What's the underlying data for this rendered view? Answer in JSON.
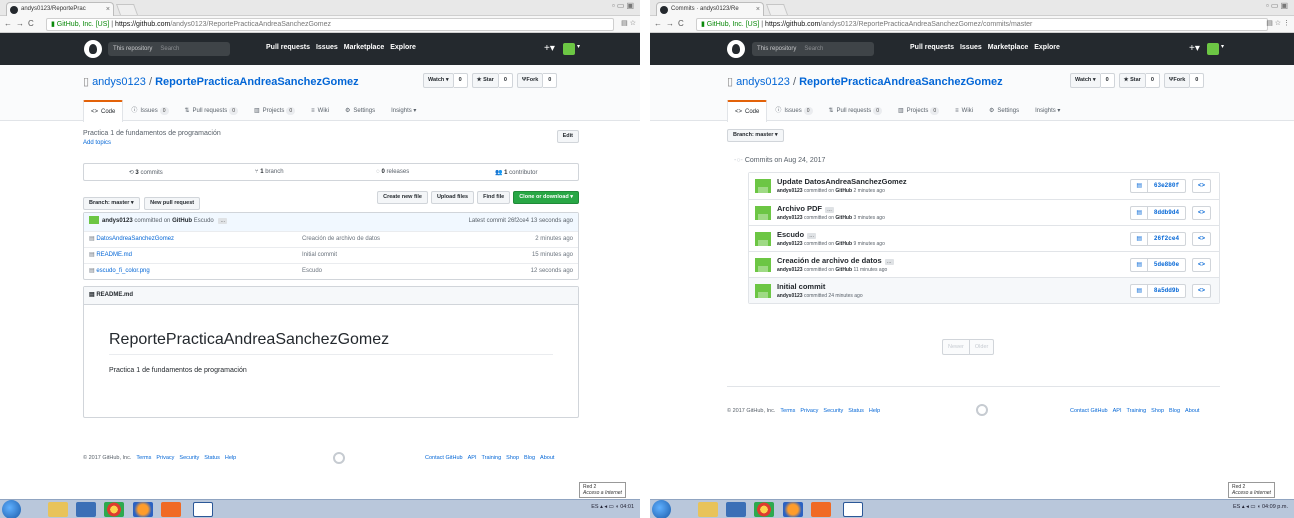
{
  "left": {
    "tab_title": "andys0123/ReportePrac",
    "url_secure": "GitHub, Inc. [US]",
    "url_host": "https://github.com",
    "url_path": "/andys0123/ReportePracticaAndreaSanchezGomez",
    "gh": {
      "repo_scope": "This repository",
      "search_placeholder": "Search",
      "links": [
        "Pull requests",
        "Issues",
        "Marketplace",
        "Explore"
      ],
      "plus": "+▾"
    },
    "repo": {
      "owner": "andys0123",
      "name": "ReportePracticaAndreaSanchezGomez",
      "watch": "Watch ▾",
      "watch_count": "0",
      "star": "★ Star",
      "star_count": "0",
      "fork": "Fork",
      "fork_count": "0"
    },
    "tabs": [
      {
        "label": "Code",
        "icon": "<>",
        "count": ""
      },
      {
        "label": "Issues",
        "icon": "ⓘ",
        "count": "0"
      },
      {
        "label": "Pull requests",
        "icon": "⇅",
        "count": "0"
      },
      {
        "label": "Projects",
        "icon": "▥",
        "count": "0"
      },
      {
        "label": "Wiki",
        "icon": "≡",
        "count": ""
      },
      {
        "label": "Settings",
        "icon": "⚙",
        "count": ""
      },
      {
        "label": "Insights ▾",
        "icon": "",
        "count": ""
      }
    ],
    "description": "Practica 1 de fundamentos de programación",
    "edit": "Edit",
    "add_topics": "Add topics",
    "summary": {
      "commits_n": "3",
      "commits": "commits",
      "branch_n": "1",
      "branch": "branch",
      "releases_n": "0",
      "releases": "releases",
      "contrib_n": "1",
      "contrib": "contributor"
    },
    "branch_btn": "Branch: master ▾",
    "new_pr": "New pull request",
    "create_file": "Create new file",
    "upload": "Upload files",
    "find": "Find file",
    "clone": "Clone or download ▾",
    "last_commit": {
      "user": "andys0123",
      "mid": "committed on",
      "via": "GitHub",
      "msg": "Escudo",
      "latest": "Latest commit 26f2ce4 13 seconds ago"
    },
    "files": [
      {
        "name": "DatosAndreaSanchezGomez",
        "msg": "Creación de archivo de datos",
        "age": "2 minutes ago"
      },
      {
        "name": "README.md",
        "msg": "Initial commit",
        "age": "15 minutes ago"
      },
      {
        "name": "escudo_fi_color.png",
        "msg": "Escudo",
        "age": "12 seconds ago"
      }
    ],
    "readme_label": "README.md",
    "readme_title": "ReportePracticaAndreaSanchezGomez",
    "readme_body": "Practica 1 de fundamentos de programación",
    "footer": {
      "copyright": "© 2017 GitHub, Inc.",
      "links": [
        "Terms",
        "Privacy",
        "Security",
        "Status",
        "Help"
      ],
      "right_links": [
        "Contact GitHub",
        "API",
        "Training",
        "Shop",
        "Blog",
        "About"
      ]
    },
    "popup_1": "Red 2",
    "popup_2": "Acceso a Internet",
    "tray": "ES  ▴  ◂  ▭  ◖  04:01"
  },
  "right": {
    "tab_title": "Commits · andys0123/Re",
    "url_secure": "GitHub, Inc. [US]",
    "url_host": "https://github.com",
    "url_path": "/andys0123/ReportePracticaAndreaSanchezGomez/commits/master",
    "branch_btn": "Branch: master ▾",
    "date_heading": "Commits on Aug 24, 2017",
    "commits": [
      {
        "msg": "Update DatosAndreaSanchezGomez",
        "user": "andys0123",
        "mid": "committed on",
        "via": "GitHub",
        "age": "2 minutes ago",
        "sha": "63e280f",
        "ell": false
      },
      {
        "msg": "Archivo PDF",
        "user": "andys0123",
        "mid": "committed on",
        "via": "GitHub",
        "age": "3 minutes ago",
        "sha": "8ddb9d4",
        "ell": true
      },
      {
        "msg": "Escudo",
        "user": "andys0123",
        "mid": "committed on",
        "via": "GitHub",
        "age": "9 minutes ago",
        "sha": "26f2ce4",
        "ell": true
      },
      {
        "msg": "Creación de archivo de datos",
        "user": "andys0123",
        "mid": "committed on",
        "via": "GitHub",
        "age": "11 minutes ago",
        "sha": "5de8b0e",
        "ell": true
      },
      {
        "msg": "Initial commit",
        "user": "andys0123",
        "mid": "committed",
        "via": "",
        "age": "24 minutes ago",
        "sha": "8a5dd9b",
        "ell": false
      }
    ],
    "newer": "Newer",
    "older": "Older",
    "popup_1": "Red 2",
    "popup_2": "Acceso a Internet",
    "tray": "ES  ▴  ◂  ▭  ◖  04:09 p.m."
  },
  "colors": {
    "accent": "#0366d6",
    "green": "#28a745",
    "header": "#24292e",
    "tab_active": "#e36209"
  },
  "icons": {
    "file": "file-icon",
    "book": "book-icon",
    "clipboard": "clipboard-icon",
    "code": "code-icon",
    "github": "github-logo-icon"
  }
}
